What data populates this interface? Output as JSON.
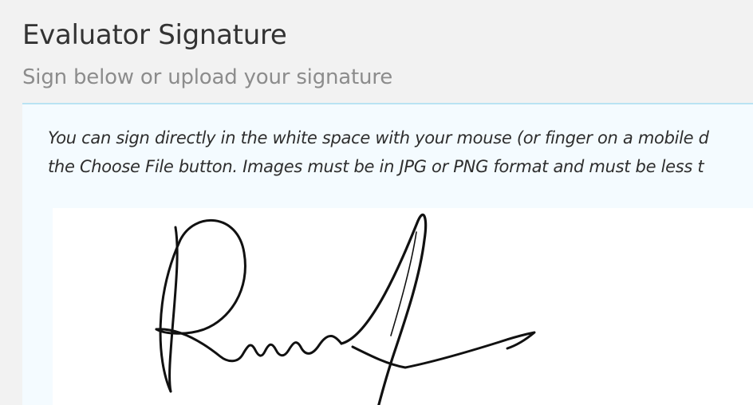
{
  "header": {
    "title": "Evaluator Signature",
    "subtitle": "Sign below or upload your signature"
  },
  "instructions": {
    "line1": "You can sign directly in the white space with your mouse (or finger on a mobile d",
    "line2": "the Choose File button. Images must be in JPG or PNG format and must be less t"
  },
  "colors": {
    "page_background": "#f2f2f2",
    "panel_background": "#f4fbff",
    "panel_border": "#b9e3f3",
    "pad_background": "#ffffff",
    "ink": "#111111"
  }
}
